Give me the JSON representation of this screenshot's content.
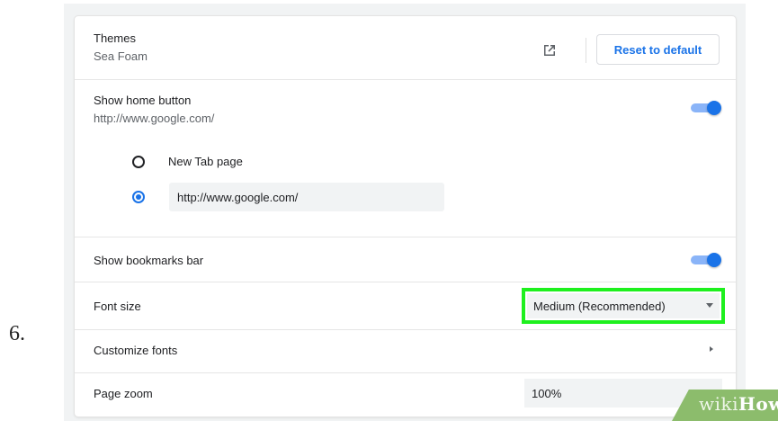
{
  "step_number": "6.",
  "themes": {
    "label": "Themes",
    "value": "Sea Foam",
    "reset_label": "Reset to default",
    "open_icon": "open-in-new-icon"
  },
  "home_button": {
    "label": "Show home button",
    "value": "http://www.google.com/",
    "enabled": true,
    "options": [
      {
        "label": "New Tab page",
        "selected": false
      },
      {
        "label": "",
        "selected": true,
        "input_value": "http://www.google.com/"
      }
    ]
  },
  "bookmarks_bar": {
    "label": "Show bookmarks bar",
    "enabled": true
  },
  "font_size": {
    "label": "Font size",
    "selected": "Medium (Recommended)"
  },
  "customize_fonts": {
    "label": "Customize fonts"
  },
  "page_zoom": {
    "label": "Page zoom",
    "value": "100%"
  },
  "watermark": {
    "part1": "wiki",
    "part2": "How"
  },
  "colors": {
    "accent": "#1a73e8",
    "highlight": "#1ef01e",
    "watermark": "#8cbc6c"
  }
}
